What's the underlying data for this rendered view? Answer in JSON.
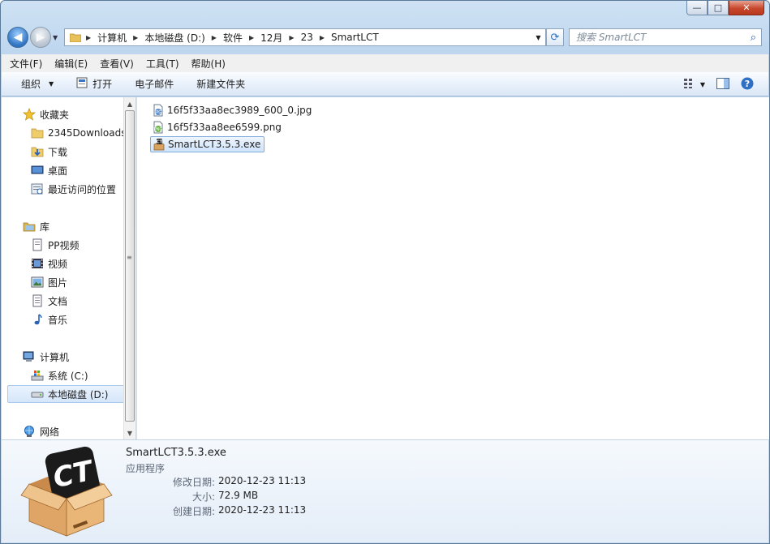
{
  "window": {
    "caption_buttons": {
      "minimize": "—",
      "maximize": "□",
      "close": "✕"
    }
  },
  "address": {
    "crumbs": [
      "计算机",
      "本地磁盘 (D:)",
      "软件",
      "12月",
      "23",
      "SmartLCT"
    ]
  },
  "search": {
    "placeholder": "搜索 SmartLCT"
  },
  "menu": [
    "文件(F)",
    "编辑(E)",
    "查看(V)",
    "工具(T)",
    "帮助(H)"
  ],
  "toolbar": {
    "organize": "组织",
    "open": "打开",
    "email": "电子邮件",
    "new_folder": "新建文件夹"
  },
  "nav": {
    "favorites": "收藏夹",
    "fav_items": [
      "2345Downloads",
      "下载",
      "桌面",
      "最近访问的位置"
    ],
    "libraries": "库",
    "lib_items": [
      "PP视频",
      "视频",
      "图片",
      "文档",
      "音乐"
    ],
    "computer": "计算机",
    "computer_items": [
      "系统 (C:)",
      "本地磁盘 (D:)"
    ],
    "network": "网络"
  },
  "files": [
    {
      "name": "16f5f33aa8ec3989_600_0.jpg",
      "icon": "jpg-file-icon"
    },
    {
      "name": "16f5f33aa8ee6599.png",
      "icon": "png-file-icon"
    },
    {
      "name": "SmartLCT3.5.3.exe",
      "icon": "exe-file-icon"
    }
  ],
  "details": {
    "name": "SmartLCT3.5.3.exe",
    "type": "应用程序",
    "modified_label": "修改日期:",
    "modified": "2020-12-23 11:13",
    "size_label": "大小:",
    "size": "72.9 MB",
    "created_label": "创建日期:",
    "created": "2020-12-23 11:13"
  }
}
